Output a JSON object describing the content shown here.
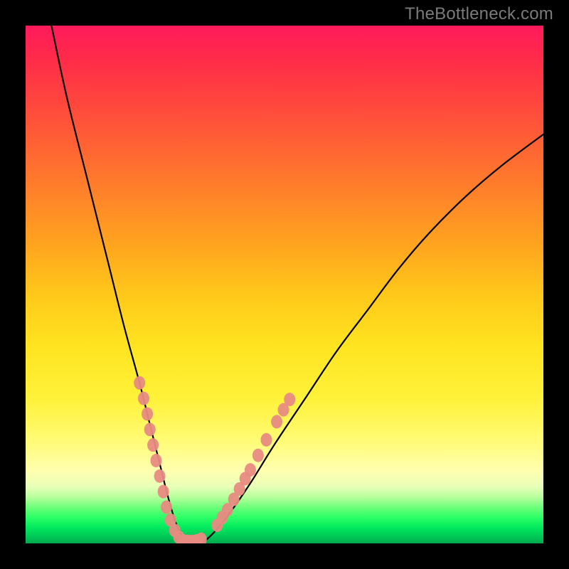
{
  "watermark": {
    "text": "TheBottleneck.com"
  },
  "chart_data": {
    "type": "line",
    "title": "",
    "xlabel": "",
    "ylabel": "",
    "xlim": [
      0,
      100
    ],
    "ylim": [
      0,
      100
    ],
    "legend": false,
    "grid": false,
    "background_gradient": {
      "direction": "vertical",
      "stops": [
        {
          "pos": 0,
          "color": "#ff1a5c"
        },
        {
          "pos": 30,
          "color": "#ff7a2c"
        },
        {
          "pos": 60,
          "color": "#ffe420"
        },
        {
          "pos": 86,
          "color": "#ffffb0"
        },
        {
          "pos": 95,
          "color": "#2bff66"
        },
        {
          "pos": 100,
          "color": "#00a84e"
        }
      ]
    },
    "series": [
      {
        "name": "curve",
        "color": "#000000",
        "x": [
          5,
          8,
          12,
          16,
          19,
          22,
          24,
          26,
          27.5,
          29,
          30.5,
          32,
          34,
          38,
          43,
          48,
          54,
          60,
          66,
          72,
          78,
          85,
          92,
          100
        ],
        "y": [
          100,
          86,
          70,
          54,
          42,
          31,
          23,
          15,
          9,
          4,
          1,
          0,
          0,
          4,
          11,
          19,
          28,
          37,
          45,
          53,
          60,
          67,
          73,
          79
        ]
      },
      {
        "name": "left-cluster-markers",
        "type": "scatter",
        "color": "#e88b82",
        "points": [
          {
            "x": 22.0,
            "y": 31
          },
          {
            "x": 22.8,
            "y": 28
          },
          {
            "x": 23.5,
            "y": 25
          },
          {
            "x": 24.0,
            "y": 22
          },
          {
            "x": 24.6,
            "y": 19
          },
          {
            "x": 25.2,
            "y": 16
          },
          {
            "x": 25.9,
            "y": 13
          },
          {
            "x": 26.6,
            "y": 10
          },
          {
            "x": 27.2,
            "y": 7
          },
          {
            "x": 28.0,
            "y": 4.5
          },
          {
            "x": 28.8,
            "y": 2.5
          },
          {
            "x": 29.6,
            "y": 1.2
          }
        ]
      },
      {
        "name": "bottom-flat-markers",
        "type": "scatter",
        "color": "#e88b82",
        "points": [
          {
            "x": 30.5,
            "y": 0.5
          },
          {
            "x": 31.4,
            "y": 0.4
          },
          {
            "x": 32.3,
            "y": 0.4
          },
          {
            "x": 33.1,
            "y": 0.5
          },
          {
            "x": 33.9,
            "y": 0.8
          }
        ]
      },
      {
        "name": "right-cluster-markers",
        "type": "scatter",
        "color": "#e88b82",
        "points": [
          {
            "x": 37.0,
            "y": 3.5
          },
          {
            "x": 38.0,
            "y": 5.0
          },
          {
            "x": 39.0,
            "y": 6.5
          },
          {
            "x": 40.2,
            "y": 8.5
          },
          {
            "x": 41.3,
            "y": 10.5
          },
          {
            "x": 42.4,
            "y": 12.5
          },
          {
            "x": 43.4,
            "y": 14.2
          },
          {
            "x": 44.9,
            "y": 17.0
          },
          {
            "x": 46.5,
            "y": 20.0
          },
          {
            "x": 48.5,
            "y": 23.5
          },
          {
            "x": 49.8,
            "y": 25.8
          },
          {
            "x": 51.0,
            "y": 27.8
          }
        ]
      }
    ]
  }
}
